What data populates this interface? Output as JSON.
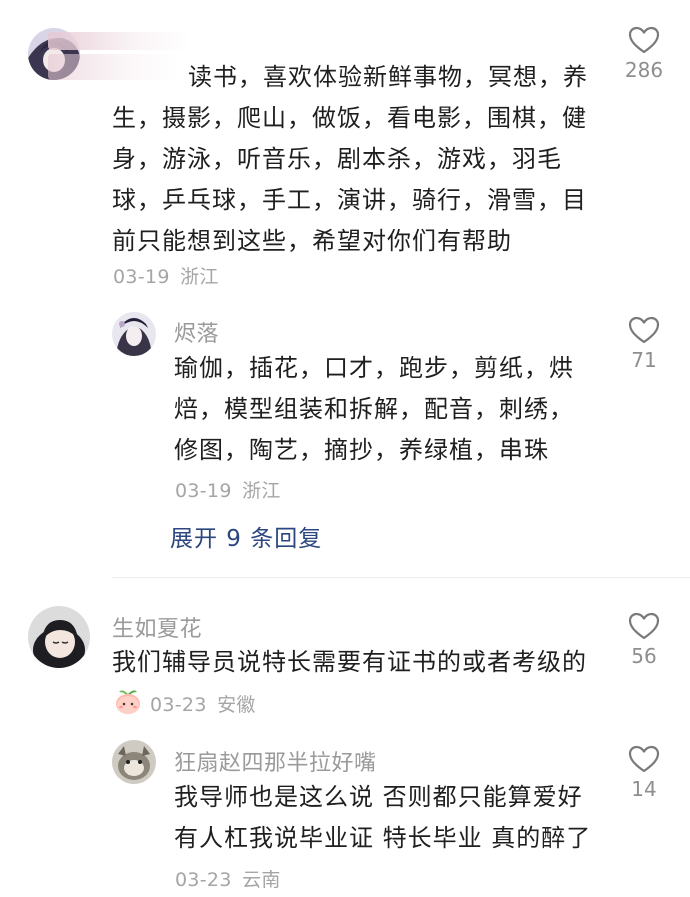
{
  "comments": [
    {
      "nickname": "",
      "text": "读书，喜欢体验新鲜事物，冥想，养生，摄影，爬山，做饭，看电影，围棋，健身，游泳，听音乐，剧本杀，游戏，羽毛球，乒乓球，手工，演讲，骑行，滑雪，目前只能想到这些，希望对你们有帮助",
      "lines": [
        "读书，喜欢体验新鲜事物，冥想，养",
        "生，摄影，爬山，做饭，看电影，围棋，健",
        "身，游泳，听音乐，剧本杀，游戏，羽毛",
        "球，乒乓球，手工，演讲，骑行，滑雪，目",
        "前只能想到这些，希望对你们有帮助"
      ],
      "date": "03-19",
      "location": "浙江",
      "likes": "286",
      "reply": {
        "nickname": "烬落",
        "lines": [
          "瑜伽，插花，口才，跑步，剪纸，烘",
          "焙，模型组装和拆解，配音，刺绣，",
          "修图，陶艺，摘抄，养绿植，串珠"
        ],
        "date": "03-19",
        "location": "浙江",
        "likes": "71"
      },
      "expand_label": "展开 9 条回复"
    },
    {
      "nickname": "生如夏花",
      "text": "我们辅导员说特长需要有证书的或者考级的",
      "date": "03-23",
      "location": "安徽",
      "likes": "56",
      "reply": {
        "nickname": "狂扇赵四那半拉好嘴",
        "lines": [
          "我导师也是这么说 否则都只能算爱好",
          "有人杠我说毕业证 特长毕业 真的醉了"
        ],
        "date": "03-23",
        "location": "云南",
        "likes": "14"
      }
    }
  ],
  "icons": {
    "like": "heart-outline-icon",
    "badge": "peach-emoji-icon"
  },
  "colors": {
    "text": "#1f1f1f",
    "meta": "#a5a5a5",
    "nickname": "#9a9a9a",
    "link": "#2c4680"
  }
}
